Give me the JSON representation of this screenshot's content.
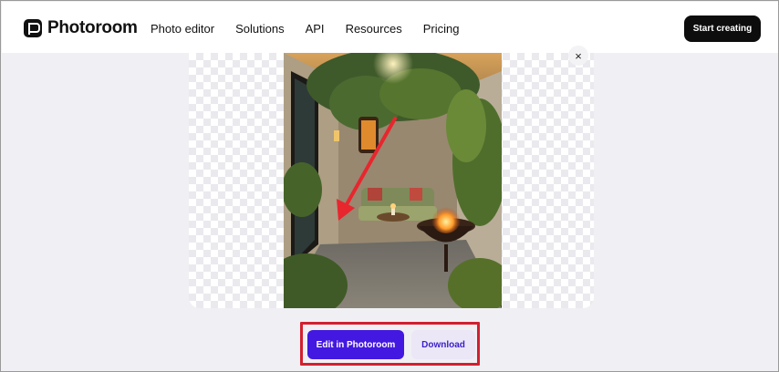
{
  "header": {
    "brand": "Photoroom",
    "nav": [
      "Photo editor",
      "Solutions",
      "API",
      "Resources",
      "Pricing"
    ],
    "cta_label": "Start creating"
  },
  "preview": {
    "close_glyph": "×",
    "image_icon": "photo-of-garden-patio-with-fire-pit",
    "annotation": "red-arrow"
  },
  "actions": {
    "edit_label": "Edit in Photoroom",
    "download_label": "Download"
  },
  "colors": {
    "primary": "#4318e0",
    "secondary_bg": "#ebe7f7",
    "highlight": "#d2202f",
    "cta_bg": "#0d0d0d"
  }
}
